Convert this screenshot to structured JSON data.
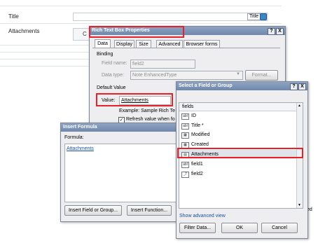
{
  "form": {
    "title_label": "Title",
    "title_tag": "Title",
    "attachments_label": "Attachments",
    "attachments_partial": "C"
  },
  "rtb": {
    "title": "Rich Text Box Properties",
    "help": "?",
    "close": "X",
    "tabs": [
      "Data",
      "Display",
      "Size",
      "Advanced",
      "Browser forms"
    ],
    "binding_heading": "Binding",
    "field_name_label": "Field name:",
    "field_name_value": "field2",
    "data_type_label": "Data type:",
    "data_type_value": "Note EnhancedType",
    "format_button": "Format...",
    "default_value_heading": "Default Value",
    "value_label": "Value:",
    "value_value": "Attachments",
    "example_text": "Example: Sample Rich Te",
    "refresh_text": "Refresh value when fo"
  },
  "formula": {
    "title": "Insert Formula",
    "formula_label": "Formula:",
    "formula_value": "Attachments",
    "insert_field_button": "Insert Field or Group...",
    "insert_function_button": "Insert Function...",
    "partial_text": "ted"
  },
  "select": {
    "title": "Select a Field or Group",
    "help": "?",
    "close": "X",
    "group_header": "fields",
    "items": [
      {
        "icon": "abc",
        "label": "ID"
      },
      {
        "icon": "abc",
        "label": "Title *"
      },
      {
        "icon": "cal",
        "label": "Modified"
      },
      {
        "icon": "cal",
        "label": "Created"
      },
      {
        "icon": "doc",
        "label": "Attachments"
      },
      {
        "icon": "abc",
        "label": "field1"
      },
      {
        "icon": "lnk",
        "label": "field2"
      }
    ],
    "show_advanced": "Show advanced view",
    "filter_button": "Filter Data...",
    "ok_button": "OK",
    "cancel_button": "Cancel"
  },
  "colors": {
    "highlight": "#e8202a",
    "title_bar": "#7a91b4"
  }
}
